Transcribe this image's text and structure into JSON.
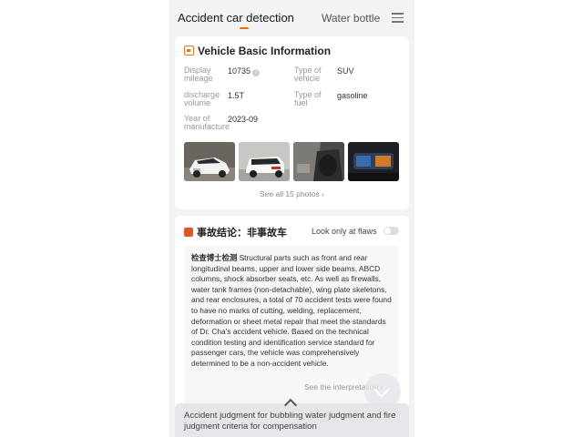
{
  "tabs": {
    "active": "Accident car detection",
    "next": "Water bottle"
  },
  "basic_info": {
    "title": "Vehicle Basic Information",
    "fields": [
      {
        "label": "Display mileage",
        "value": "10735"
      },
      {
        "label": "Type of vehicle",
        "value": "SUV"
      },
      {
        "label": "discharge volume",
        "value": "1.5T"
      },
      {
        "label": "Type of fuel",
        "value": "gasoline"
      },
      {
        "label": "Year of manufacture",
        "value": "2023-09"
      }
    ],
    "see_all": "See all 15 photos"
  },
  "accident": {
    "title": "事故结论：非事故车",
    "flaws_label": "Look only at flaws",
    "expert_name": "检查博士检测",
    "expert_text": "Structural parts such as front and rear longitudinal beams, upper and lower side beams, ABCD columns, shock absorber seats, etc. As well as firewalls, water tank frames (non-detachable), wing plate skeletons, and rear enclosures, a total of 70 accident tests were found to have no marks of cutting, welding, replacement, deformation or sheet metal repair that meet the standards of Dr. Cha's accident vehicle. Based on the technical condition testing and identification service standard for passenger cars, the vehicle was comprehensively determined to be a non-accident vehicle.",
    "see_interpretation": "See the interpretation"
  },
  "bottom_sheet": {
    "text": "Accident judgment for bubbling water judgment and fire judgment criteria for compensation"
  },
  "colors": {
    "accent": "#ff6a00",
    "background": "#f3f3f5"
  }
}
